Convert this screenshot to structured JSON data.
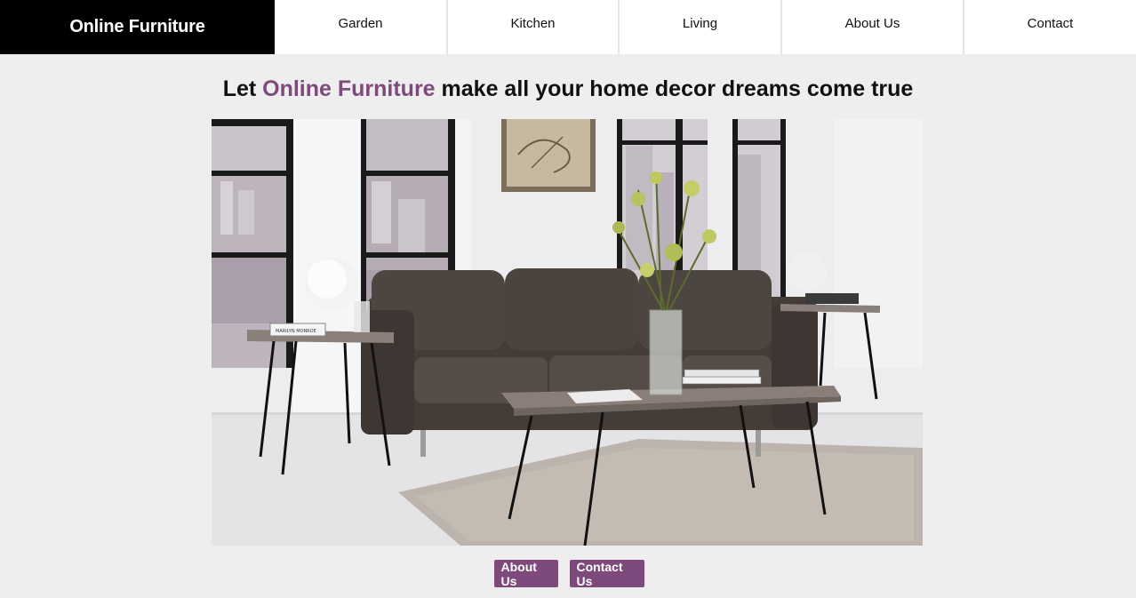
{
  "brand": {
    "name": "Online Furniture"
  },
  "nav": {
    "garden": "Garden",
    "kitchen": "Kitchen",
    "living": "Living",
    "about": "About Us",
    "contact": "Contact"
  },
  "hero": {
    "headline_prefix": "Let ",
    "headline_brand": "Online Furniture",
    "headline_suffix": " make all your home decor dreams come true",
    "book_label": "MARILYN MONROE"
  },
  "buttons": {
    "about": "About Us",
    "contact": "Contact Us"
  },
  "colors": {
    "accent": "#7d4a7b",
    "brand_bg": "#000000",
    "page_bg": "#eeeeee"
  }
}
